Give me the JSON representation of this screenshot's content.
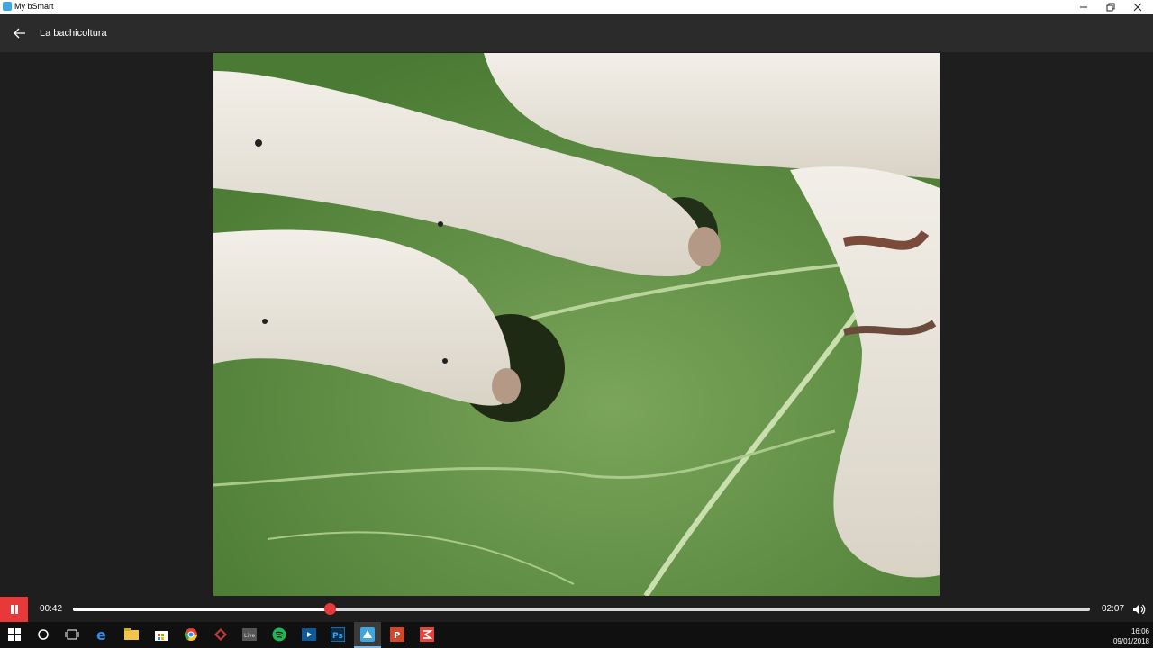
{
  "window": {
    "title": "My bSmart",
    "controls": [
      "minimize",
      "restore",
      "close"
    ]
  },
  "header": {
    "title": "La bachicoltura",
    "back_icon": "arrow-left-icon"
  },
  "video": {
    "description_icon": "video-frame"
  },
  "player": {
    "current_time": "00:42",
    "duration": "02:07",
    "progress": 0.252,
    "state_icon": "pause-icon",
    "accent_color": "#e8393a"
  },
  "taskbar": {
    "items": [
      "windows-start-icon",
      "cortana-search-icon",
      "task-view-icon",
      "edge-icon",
      "file-explorer-icon",
      "store-icon",
      "chrome-icon",
      "app-icon",
      "live-icon",
      "spotify-icon",
      "media-icon",
      "photoshop-icon",
      "bsmart-icon",
      "powerpoint-icon",
      "app-red-icon"
    ],
    "live_label": "Live",
    "ps_label": "Ps",
    "clock_time": "16:06",
    "clock_date": "09/01/2018"
  }
}
